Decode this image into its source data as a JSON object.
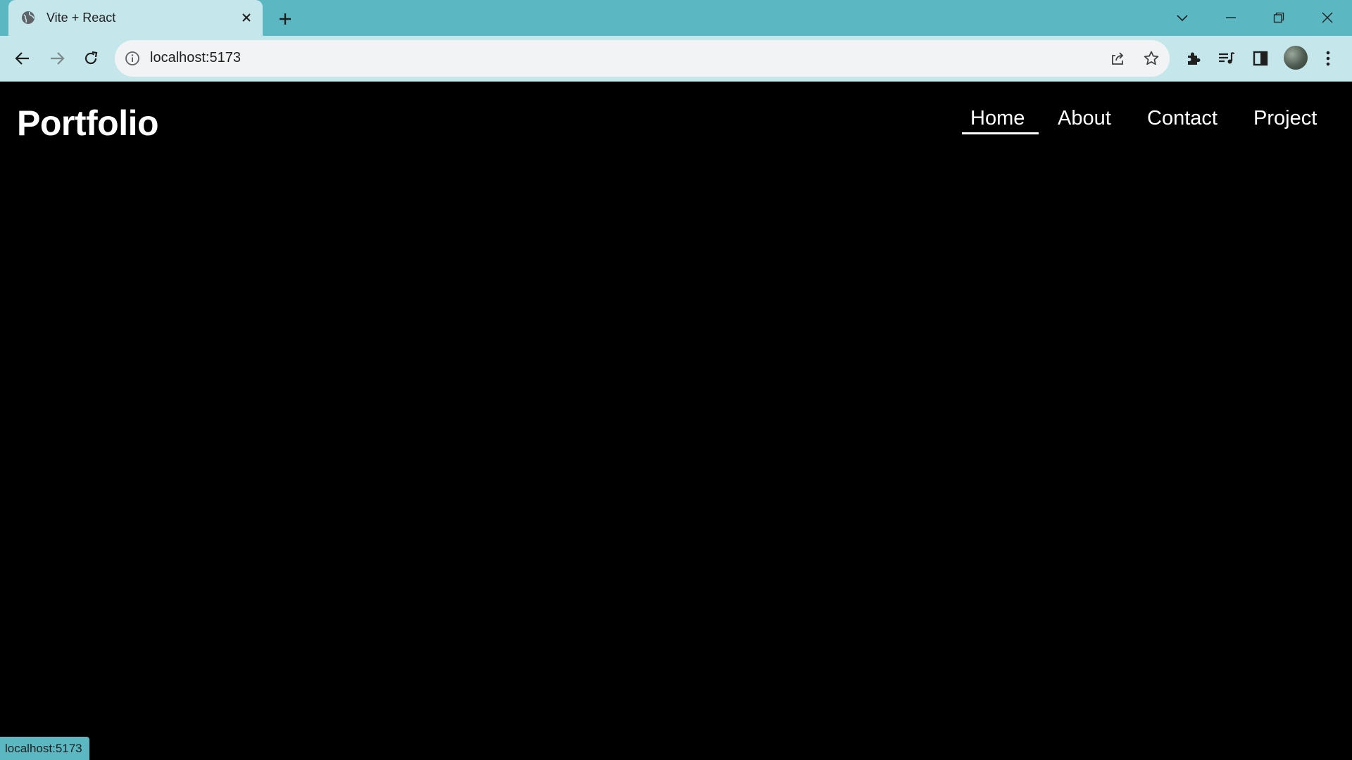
{
  "browser": {
    "tab_title": "Vite + React",
    "url": "localhost:5173",
    "status_url": "localhost:5173",
    "colors": {
      "tabstrip": "#5bb8c3",
      "toolbar": "#c5e6ea"
    },
    "icons": {
      "favicon": "globe-icon",
      "close": "close-icon",
      "new_tab": "plus-icon",
      "back": "back-arrow-icon",
      "forward": "forward-arrow-icon",
      "reload": "reload-icon",
      "site_info": "info-icon",
      "share": "share-icon",
      "bookmark": "star-icon",
      "extensions": "puzzle-icon",
      "media": "media-queue-icon",
      "side_panel": "side-panel-icon",
      "menu": "kebab-menu-icon"
    }
  },
  "page": {
    "logo": "Portfolio",
    "nav": {
      "home": "Home",
      "about": "About",
      "contact": "Contact",
      "project": "Project",
      "active": "Home"
    },
    "colors": {
      "background": "#000000",
      "text": "#ffffff"
    }
  }
}
